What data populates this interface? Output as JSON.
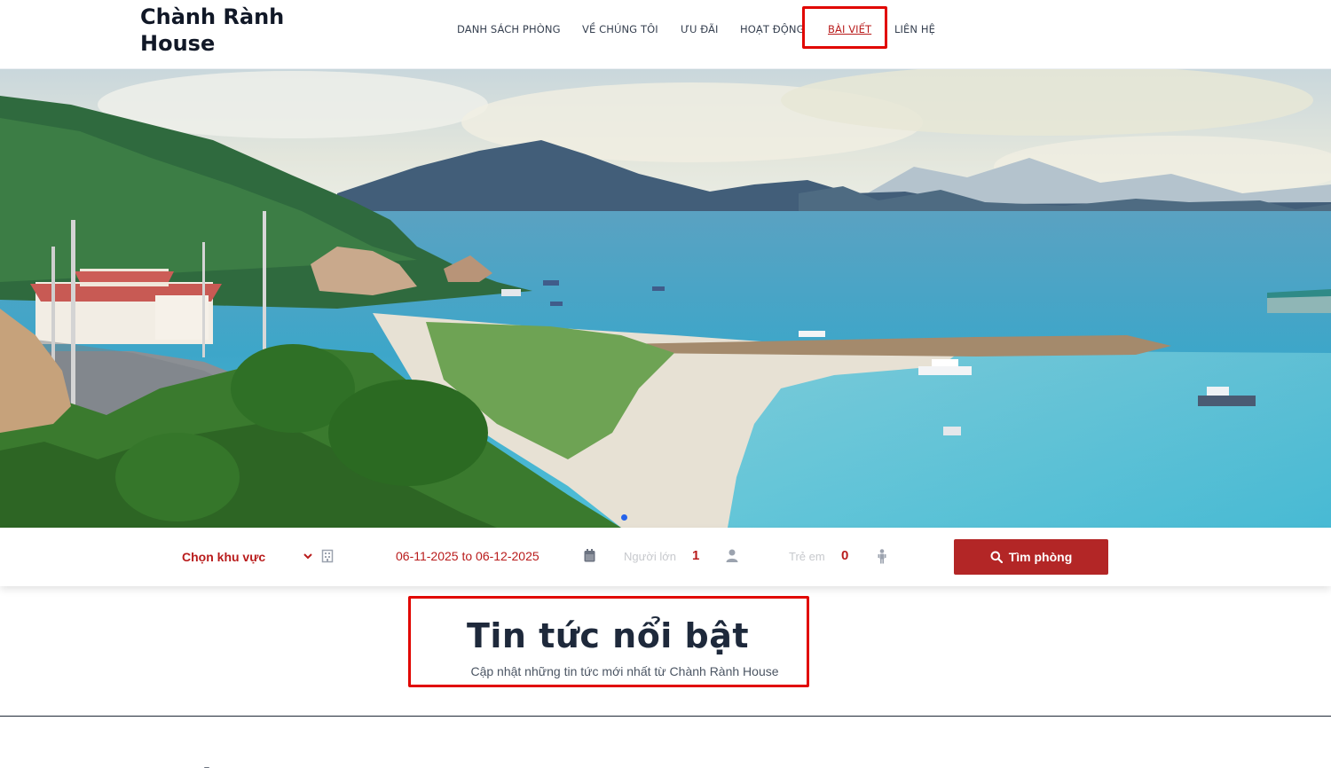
{
  "header": {
    "logo_text": "Chành Rành House",
    "nav": [
      {
        "label": "DANH SÁCH PHÒNG",
        "active": false
      },
      {
        "label": "VỀ CHÚNG TÔI",
        "active": false
      },
      {
        "label": "ƯU ĐÃI",
        "active": false
      },
      {
        "label": "HOẠT ĐỘNG",
        "active": false
      },
      {
        "label": "BÀI VIẾT",
        "active": true
      },
      {
        "label": "LIÊN HỆ",
        "active": false
      }
    ]
  },
  "search": {
    "region_placeholder": "Chọn khu vực",
    "dates": "06-11-2025 to 06-12-2025",
    "adults_label": "Người lớn",
    "adults_count": "1",
    "children_label": "Trẻ em",
    "children_count": "0",
    "submit_label": "Tìm phòng"
  },
  "featured": {
    "title": "Tin tức nổi bật",
    "subtitle": "Cập nhật những tin tức mới nhất từ Chành Rành House"
  },
  "colors": {
    "accent": "#b32626",
    "highlight_box": "#e10600",
    "sea": "#3aa7c8",
    "sky": "#dfe8ea"
  },
  "icons": [
    "chevron-down-icon",
    "building-icon",
    "calendar-icon",
    "user-icon",
    "child-icon",
    "search-icon"
  ]
}
